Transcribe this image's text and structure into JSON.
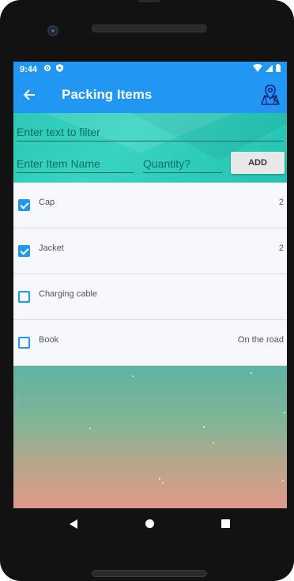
{
  "status_bar": {
    "time": "9:44"
  },
  "app_bar": {
    "title": "Packing Items"
  },
  "filter": {
    "placeholder": "Enter text to filter"
  },
  "add_form": {
    "item_placeholder": "Enter Item Name",
    "quantity_placeholder": "Quantity?",
    "add_label": "ADD"
  },
  "items": [
    {
      "name": "Cap",
      "quantity": "2",
      "checked": true
    },
    {
      "name": "Jacket",
      "quantity": "2",
      "checked": true
    },
    {
      "name": "Charging cable",
      "quantity": "",
      "checked": false
    },
    {
      "name": "Book",
      "quantity": "On the road",
      "checked": false
    }
  ],
  "colors": {
    "primary": "#2196f3",
    "accent": "#2cc9b7"
  }
}
